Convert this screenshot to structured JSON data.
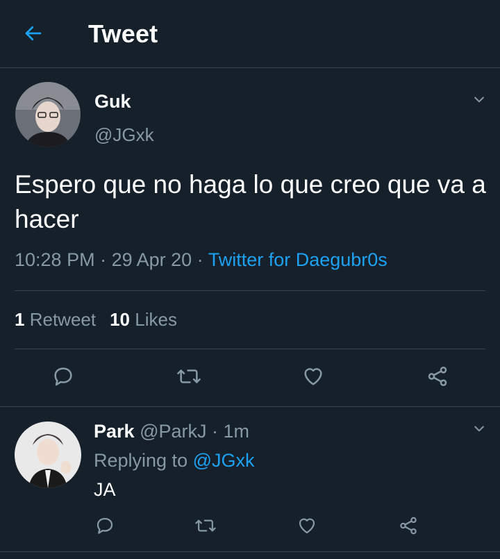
{
  "header": {
    "title": "Tweet",
    "back_icon": "arrow-left-icon"
  },
  "colors": {
    "background": "#15202b",
    "accent": "#1da1f2",
    "muted": "#8899a6",
    "divider": "#38444d"
  },
  "tweet": {
    "display_name": "Guk",
    "handle": "@JGxk",
    "text": "Espero que no haga lo que creo que va a hacer",
    "time": "10:28 PM",
    "sep1": " · ",
    "date": "29 Apr 20",
    "sep2": " · ",
    "source": "Twitter for Daegubr0s",
    "retweet_count": "1",
    "retweet_label": "Retweet",
    "like_count": "10",
    "like_label": "Likes",
    "actions": [
      "reply-icon",
      "retweet-icon",
      "heart-icon",
      "share-icon"
    ]
  },
  "reply": {
    "display_name": "Park",
    "handle": "@ParkJ",
    "sep": " · ",
    "time": "1m",
    "replying_prefix": "Replying to ",
    "replying_to": "@JGxk",
    "text": "JA",
    "actions": [
      "reply-icon",
      "retweet-icon",
      "heart-icon",
      "share-icon"
    ]
  }
}
